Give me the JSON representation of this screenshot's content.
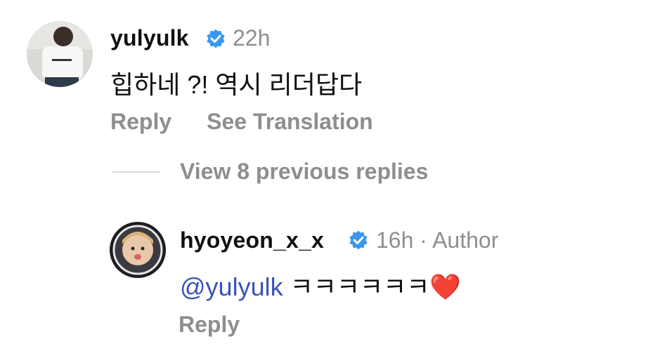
{
  "comments": [
    {
      "username": "yulyulk",
      "time": "22h",
      "text": "힙하네 ?! 역시 리더답다",
      "actions": {
        "reply": "Reply",
        "translate": "See Translation"
      }
    },
    {
      "username": "hyoyeon_x_x",
      "time": "16h · Author",
      "mention": "@yulyulk",
      "text": "ㅋㅋㅋㅋㅋㅋ",
      "emoji": "❤️",
      "actions": {
        "reply": "Reply"
      }
    }
  ],
  "thread": {
    "view_replies": "View 8 previous replies"
  },
  "colors": {
    "meta": "#8e8e8e",
    "verified": "#3897f0",
    "mention": "#3a54b4"
  },
  "icons": [
    "verified-badge-icon"
  ]
}
